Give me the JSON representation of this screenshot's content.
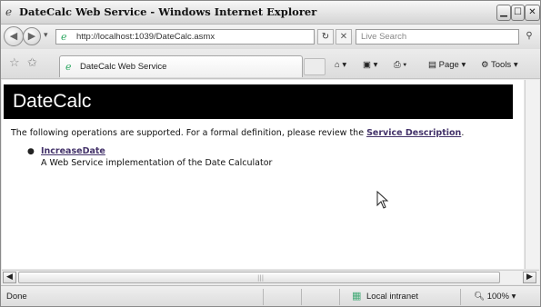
{
  "window": {
    "title": "DateCalc Web Service - Windows Internet Explorer"
  },
  "address_bar": {
    "url": "http://localhost:1039/DateCalc.asmx",
    "search_placeholder": "Live Search"
  },
  "tab": {
    "label": "DateCalc Web Service"
  },
  "commands": {
    "page_label": "Page",
    "tools_label": "Tools"
  },
  "page": {
    "heading": "DateCalc",
    "intro_prefix": "The following operations are supported. For a formal definition, please review the ",
    "service_description_link": "Service Description",
    "intro_suffix": ".",
    "operations": [
      {
        "name": "IncreaseDate",
        "description": "A Web Service implementation of the Date Calculator"
      }
    ]
  },
  "status_bar": {
    "status": "Done",
    "zone": "Local intranet",
    "zoom": "100%"
  },
  "icons": {
    "ie_logo": "ie-logo-icon",
    "back": "back-arrow-icon",
    "forward": "forward-arrow-icon",
    "refresh": "refresh-icon",
    "stop": "stop-icon",
    "search": "search-icon",
    "favorites": "favorites-star-icon",
    "add_favorites": "add-favorites-icon",
    "home": "home-icon",
    "feeds": "feeds-icon",
    "print": "print-icon",
    "zone": "local-intranet-icon"
  }
}
